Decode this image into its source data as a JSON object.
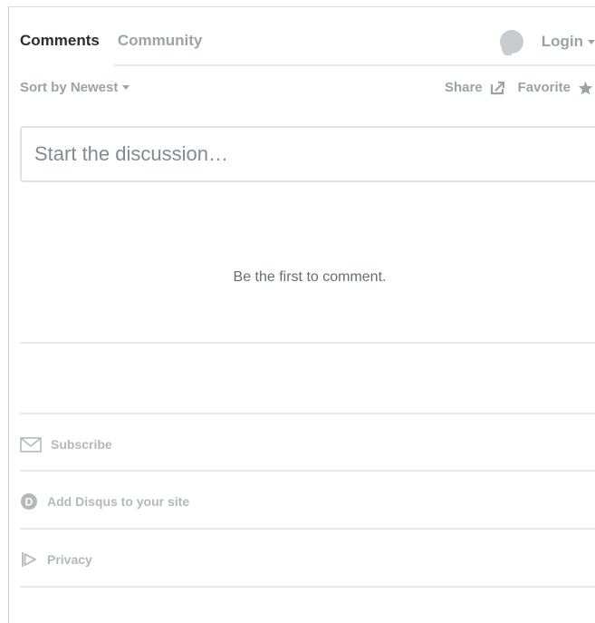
{
  "tabs": {
    "comments": "Comments",
    "community": "Community"
  },
  "login": {
    "label": "Login"
  },
  "toolbar": {
    "sort_label": "Sort by Newest",
    "share_label": "Share",
    "favorite_label": "Favorite"
  },
  "composer": {
    "placeholder": "Start the discussion…"
  },
  "empty_state": "Be the first to comment.",
  "footer": {
    "subscribe": "Subscribe",
    "add_disqus": "Add Disqus to your site",
    "privacy": "Privacy"
  },
  "icons": [
    "avatar",
    "share-icon",
    "star-icon",
    "envelope-icon",
    "disqus-icon",
    "privacy-icon"
  ]
}
